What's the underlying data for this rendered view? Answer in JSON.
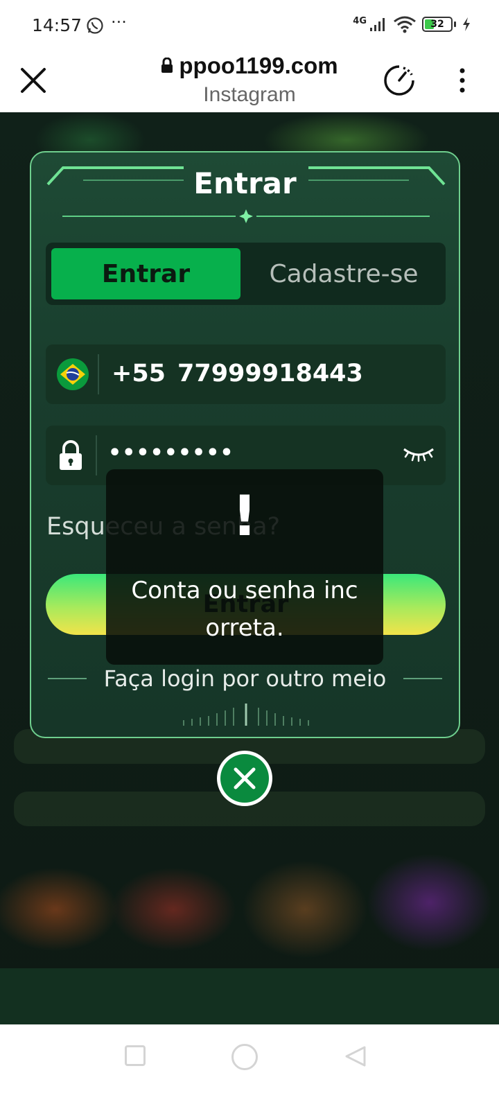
{
  "status_bar": {
    "time": "14:57",
    "more": "···",
    "network": "4G",
    "battery": "32"
  },
  "browser": {
    "url": "ppoo1199.com",
    "subtitle": "Instagram"
  },
  "modal": {
    "title": "Entrar",
    "tabs": [
      {
        "label": "Entrar",
        "active": true
      },
      {
        "label": "Cadastre-se",
        "active": false
      }
    ],
    "phone": {
      "country_code": "+55",
      "number": "77999918443"
    },
    "password": {
      "masked": "•••••••••"
    },
    "forgot_label": "Esqueceu a senha?",
    "login_button_label": "Entrar",
    "other_login_label": "Faça login por outro meio"
  },
  "toast": {
    "icon": "!",
    "message": "Conta ou senha incorreta."
  },
  "colors": {
    "accent": "#07b04c",
    "modal_border": "#6fcf8e",
    "button_top": "#3be77a",
    "button_bottom": "#f2e34a"
  }
}
